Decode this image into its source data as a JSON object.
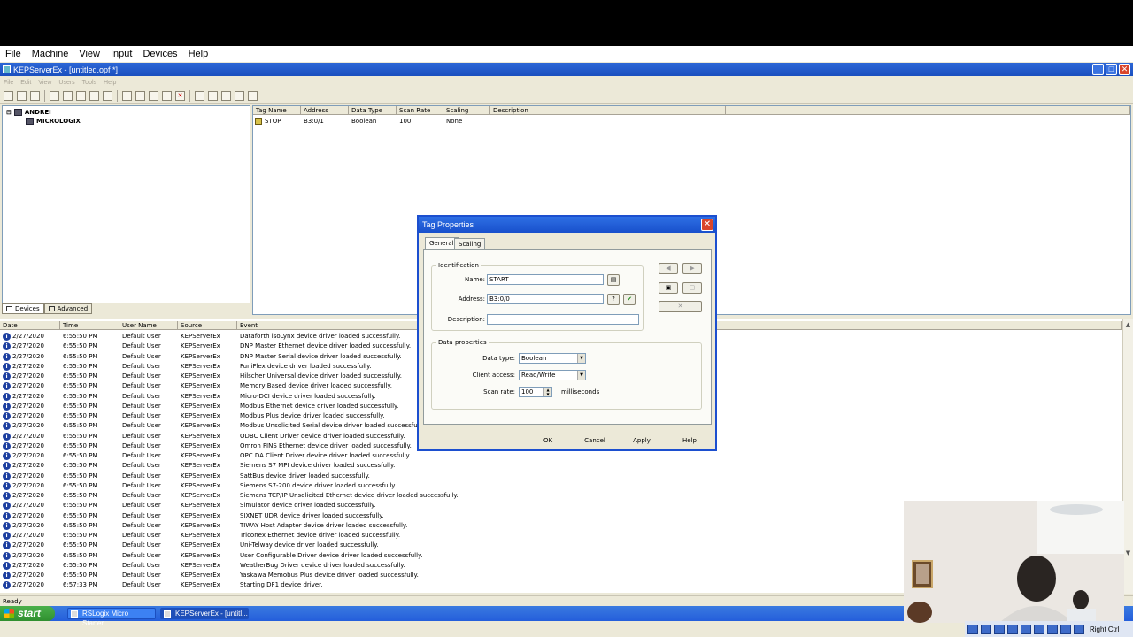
{
  "outer_menu": [
    "File",
    "Machine",
    "View",
    "Input",
    "Devices",
    "Help"
  ],
  "window": {
    "title": "KEPServerEx - [untitled.opf *]"
  },
  "inner_menu": [
    "File",
    "Edit",
    "View",
    "Users",
    "Tools",
    "Help"
  ],
  "tree": {
    "channel": "ANDREI",
    "device": "MICROLOGIX",
    "tabs": [
      "Devices",
      "Advanced"
    ]
  },
  "tag_table": {
    "headers": [
      "Tag Name",
      "Address",
      "Data Type",
      "Scan Rate",
      "Scaling",
      "Description"
    ],
    "rows": [
      [
        "STOP",
        "B3:0/1",
        "Boolean",
        "100",
        "None",
        ""
      ]
    ]
  },
  "event_log": {
    "headers": [
      "Date",
      "Time",
      "User Name",
      "Source",
      "Event"
    ],
    "rows": [
      [
        "2/27/2020",
        "6:55:50 PM",
        "Default User",
        "KEPServerEx",
        "Dataforth isoLynx device driver loaded successfully."
      ],
      [
        "2/27/2020",
        "6:55:50 PM",
        "Default User",
        "KEPServerEx",
        "DNP Master Ethernet device driver loaded successfully."
      ],
      [
        "2/27/2020",
        "6:55:50 PM",
        "Default User",
        "KEPServerEx",
        "DNP Master Serial device driver loaded successfully."
      ],
      [
        "2/27/2020",
        "6:55:50 PM",
        "Default User",
        "KEPServerEx",
        "FuniFlex device driver loaded successfully."
      ],
      [
        "2/27/2020",
        "6:55:50 PM",
        "Default User",
        "KEPServerEx",
        "Hilscher Universal device driver loaded successfully."
      ],
      [
        "2/27/2020",
        "6:55:50 PM",
        "Default User",
        "KEPServerEx",
        "Memory Based device driver loaded successfully."
      ],
      [
        "2/27/2020",
        "6:55:50 PM",
        "Default User",
        "KEPServerEx",
        "Micro-DCI device driver loaded successfully."
      ],
      [
        "2/27/2020",
        "6:55:50 PM",
        "Default User",
        "KEPServerEx",
        "Modbus Ethernet device driver loaded successfully."
      ],
      [
        "2/27/2020",
        "6:55:50 PM",
        "Default User",
        "KEPServerEx",
        "Modbus Plus device driver loaded successfully."
      ],
      [
        "2/27/2020",
        "6:55:50 PM",
        "Default User",
        "KEPServerEx",
        "Modbus Unsolicited Serial device driver loaded successfully."
      ],
      [
        "2/27/2020",
        "6:55:50 PM",
        "Default User",
        "KEPServerEx",
        "ODBC Client Driver device driver loaded successfully."
      ],
      [
        "2/27/2020",
        "6:55:50 PM",
        "Default User",
        "KEPServerEx",
        "Omron FINS Ethernet device driver loaded successfully."
      ],
      [
        "2/27/2020",
        "6:55:50 PM",
        "Default User",
        "KEPServerEx",
        "OPC DA Client Driver device driver loaded successfully."
      ],
      [
        "2/27/2020",
        "6:55:50 PM",
        "Default User",
        "KEPServerEx",
        "Siemens S7 MPI device driver loaded successfully."
      ],
      [
        "2/27/2020",
        "6:55:50 PM",
        "Default User",
        "KEPServerEx",
        "SattBus device driver loaded successfully."
      ],
      [
        "2/27/2020",
        "6:55:50 PM",
        "Default User",
        "KEPServerEx",
        "Siemens S7-200 device driver loaded successfully."
      ],
      [
        "2/27/2020",
        "6:55:50 PM",
        "Default User",
        "KEPServerEx",
        "Siemens TCP/IP Unsolicited Ethernet device driver loaded successfully."
      ],
      [
        "2/27/2020",
        "6:55:50 PM",
        "Default User",
        "KEPServerEx",
        "Simulator device driver loaded successfully."
      ],
      [
        "2/27/2020",
        "6:55:50 PM",
        "Default User",
        "KEPServerEx",
        "SIXNET UDR device driver loaded successfully."
      ],
      [
        "2/27/2020",
        "6:55:50 PM",
        "Default User",
        "KEPServerEx",
        "TIWAY Host Adapter device driver loaded successfully."
      ],
      [
        "2/27/2020",
        "6:55:50 PM",
        "Default User",
        "KEPServerEx",
        "Triconex Ethernet device driver loaded successfully."
      ],
      [
        "2/27/2020",
        "6:55:50 PM",
        "Default User",
        "KEPServerEx",
        "Uni-Telway device driver loaded successfully."
      ],
      [
        "2/27/2020",
        "6:55:50 PM",
        "Default User",
        "KEPServerEx",
        "User Configurable Driver device driver loaded successfully."
      ],
      [
        "2/27/2020",
        "6:55:50 PM",
        "Default User",
        "KEPServerEx",
        "WeatherBug Driver device driver loaded successfully."
      ],
      [
        "2/27/2020",
        "6:55:50 PM",
        "Default User",
        "KEPServerEx",
        "Yaskawa Memobus Plus device driver loaded successfully."
      ],
      [
        "2/27/2020",
        "6:57:33 PM",
        "Default User",
        "KEPServerEx",
        "Starting DF1 device driver."
      ]
    ]
  },
  "status_bar": "Ready",
  "taskbar": {
    "start": "start",
    "tasks": [
      "RSLogix Micro Starter...",
      "KEPServerEx - [untitl..."
    ],
    "tray_text": "Right Ctrl"
  },
  "dialog": {
    "title": "Tag Properties",
    "close": "✕",
    "tabs": [
      "General",
      "Scaling"
    ],
    "identification_label": "Identification",
    "name_label": "Name:",
    "name_value": "START",
    "address_label": "Address:",
    "address_value": "B3:0/0",
    "description_label": "Description:",
    "description_value": "",
    "data_properties_label": "Data properties",
    "data_type_label": "Data type:",
    "data_type_value": "Boolean",
    "client_access_label": "Client access:",
    "client_access_value": "Read/Write",
    "scan_rate_label": "Scan rate:",
    "scan_rate_value": "100",
    "scan_rate_unit": "milliseconds",
    "buttons": [
      "OK",
      "Cancel",
      "Apply",
      "Help"
    ]
  }
}
